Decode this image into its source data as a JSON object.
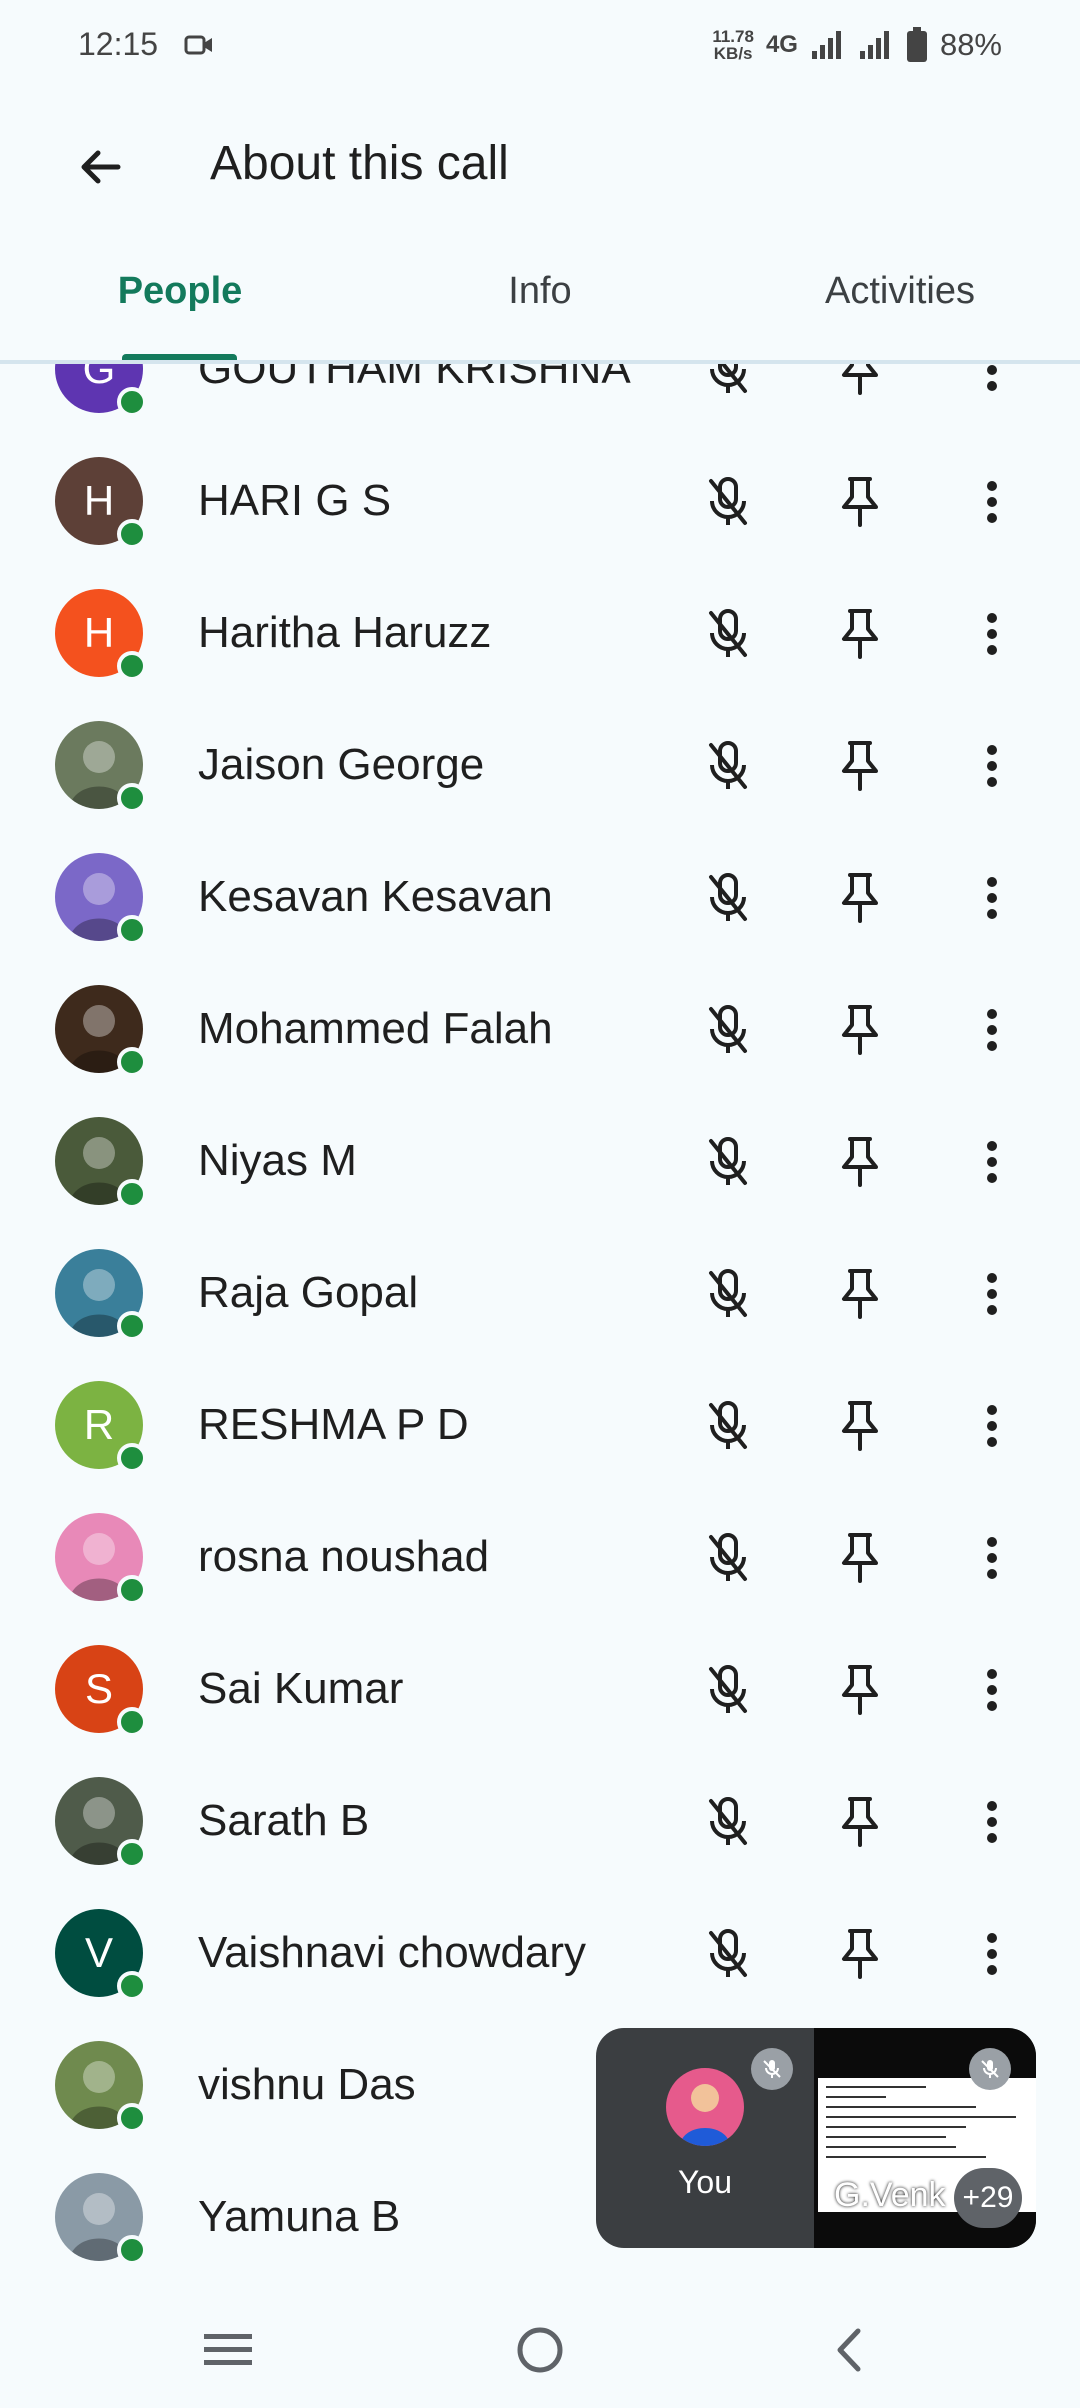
{
  "status_bar": {
    "time": "12:15",
    "speed_value": "11.78",
    "speed_unit": "KB/s",
    "network": "4G",
    "battery": "88%"
  },
  "app_bar": {
    "title": "About this call"
  },
  "tabs": [
    {
      "label": "People",
      "active": true
    },
    {
      "label": "Info",
      "active": false
    },
    {
      "label": "Activities",
      "active": false
    }
  ],
  "participants": [
    {
      "name": "GOUTHAM KRISHNA",
      "initial": "G",
      "color": "#5e35b1"
    },
    {
      "name": "HARI G S",
      "initial": "H",
      "color": "#5d4037"
    },
    {
      "name": "Haritha Haruzz",
      "initial": "H",
      "color": "#f4511e"
    },
    {
      "name": "Jaison George",
      "initial": "",
      "color": "#6b7a5e"
    },
    {
      "name": "Kesavan Kesavan",
      "initial": "",
      "color": "#7b68c8"
    },
    {
      "name": "Mohammed Falah",
      "initial": "",
      "color": "#3e2a1c"
    },
    {
      "name": "Niyas M",
      "initial": "",
      "color": "#4a5a3a"
    },
    {
      "name": "Raja Gopal",
      "initial": "",
      "color": "#3a7f9a"
    },
    {
      "name": "RESHMA P D",
      "initial": "R",
      "color": "#7cb342"
    },
    {
      "name": "rosna noushad",
      "initial": "",
      "color": "#e889b8"
    },
    {
      "name": "Sai Kumar",
      "initial": "S",
      "color": "#d84315"
    },
    {
      "name": "Sarath B",
      "initial": "",
      "color": "#4f5b4a"
    },
    {
      "name": "Vaishnavi chowdary",
      "initial": "V",
      "color": "#004d40"
    },
    {
      "name": "vishnu Das",
      "initial": "",
      "color": "#6f8a4e"
    },
    {
      "name": "Yamuna B",
      "initial": "",
      "color": "#8a9aa6"
    }
  ],
  "pip": {
    "self_label": "You",
    "other_name": "G.Venk",
    "overflow_count": "+29"
  }
}
